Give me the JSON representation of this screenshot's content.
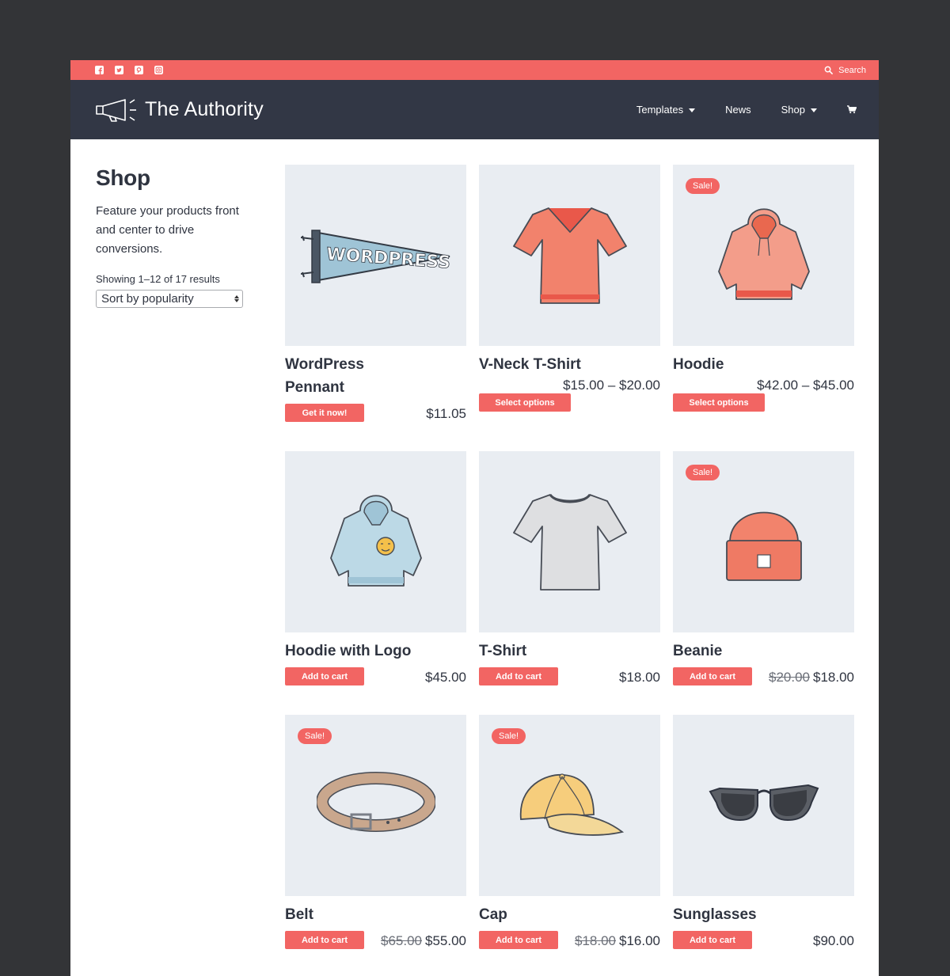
{
  "topbar": {
    "social_icons": [
      "facebook-icon",
      "twitter-icon",
      "pinterest-icon",
      "instagram-icon"
    ],
    "search_label": "Search"
  },
  "header": {
    "brand": "The Authority",
    "nav": [
      {
        "label": "Templates",
        "dropdown": true
      },
      {
        "label": "News",
        "dropdown": false
      },
      {
        "label": "Shop",
        "dropdown": true
      }
    ],
    "cart_icon": "cart-icon"
  },
  "sidebar": {
    "title": "Shop",
    "description": "Feature your products front and center to drive conversions.",
    "result_count": "Showing 1–12 of 17 results",
    "sort_value": "Sort by popularity"
  },
  "products": [
    {
      "name": "WordPress Pennant",
      "button": "Get it now!",
      "price": "$11.05",
      "old_price": "",
      "sale": false
    },
    {
      "name": "V-Neck T-Shirt",
      "button": "Select options",
      "price": "$15.00 – $20.00",
      "old_price": "",
      "sale": false
    },
    {
      "name": "Hoodie",
      "button": "Select options",
      "price": "$42.00 – $45.00",
      "old_price": "",
      "sale": true
    },
    {
      "name": "Hoodie with Logo",
      "button": "Add to cart",
      "price": "$45.00",
      "old_price": "",
      "sale": false
    },
    {
      "name": "T-Shirt",
      "button": "Add to cart",
      "price": "$18.00",
      "old_price": "",
      "sale": false
    },
    {
      "name": "Beanie",
      "button": "Add to cart",
      "price": "$18.00",
      "old_price": "$20.00",
      "sale": true
    },
    {
      "name": "Belt",
      "button": "Add to cart",
      "price": "$55.00",
      "old_price": "$65.00",
      "sale": true
    },
    {
      "name": "Cap",
      "button": "Add to cart",
      "price": "$16.00",
      "old_price": "$18.00",
      "sale": true
    },
    {
      "name": "Sunglasses",
      "button": "Add to cart",
      "price": "$90.00",
      "old_price": "",
      "sale": false
    }
  ],
  "sale_label": "Sale!",
  "colors": {
    "accent": "#f26563",
    "header": "#323745",
    "card_bg": "#e9edf2",
    "backdrop": "#333437"
  }
}
